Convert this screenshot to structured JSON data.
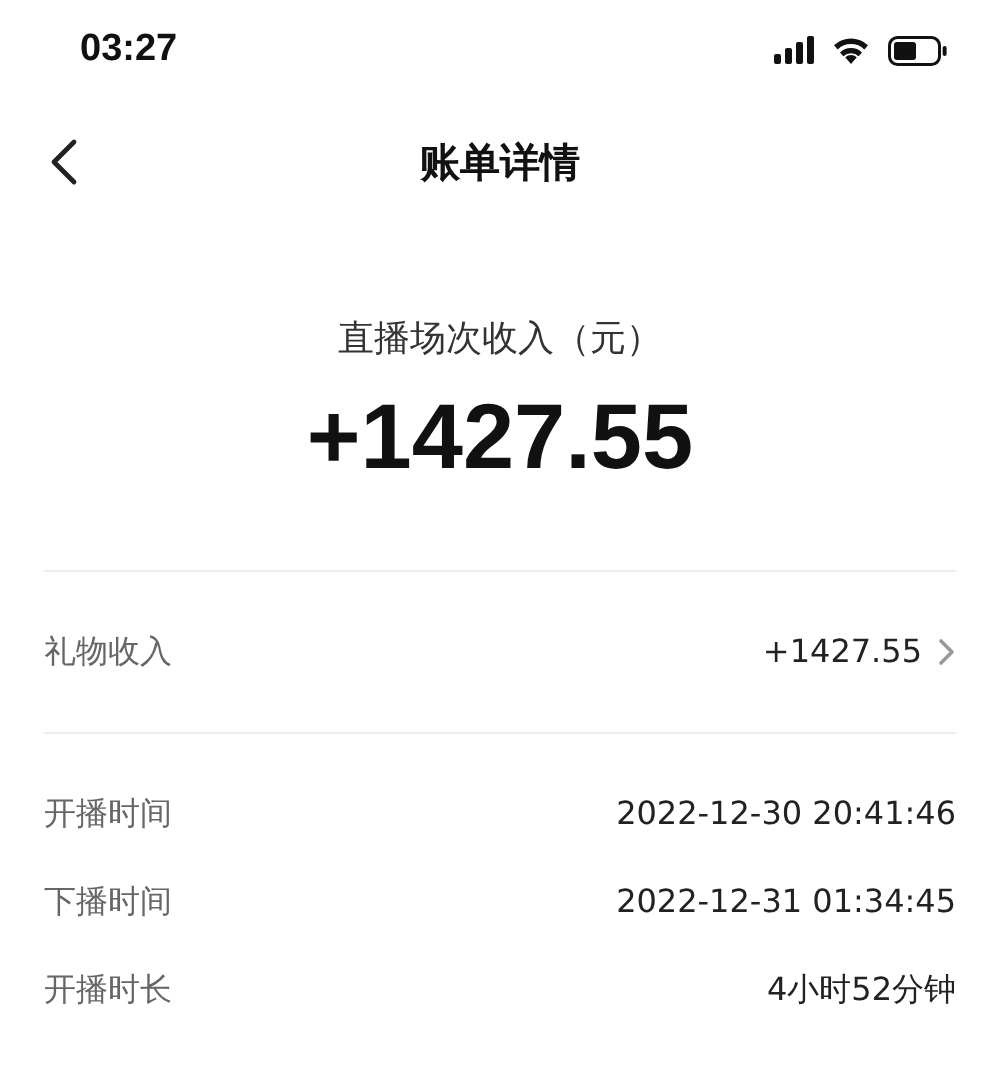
{
  "status_bar": {
    "time": "03:27"
  },
  "nav": {
    "title": "账单详情"
  },
  "summary": {
    "label": "直播场次收入（元）",
    "amount": "+1427.55"
  },
  "income_row": {
    "label": "礼物收入",
    "value": "+1427.55"
  },
  "details": [
    {
      "label": "开播时间",
      "value": "2022-12-30 20:41:46"
    },
    {
      "label": "下播时间",
      "value": "2022-12-31 01:34:45"
    },
    {
      "label": "开播时长",
      "value": "4小时52分钟"
    }
  ]
}
